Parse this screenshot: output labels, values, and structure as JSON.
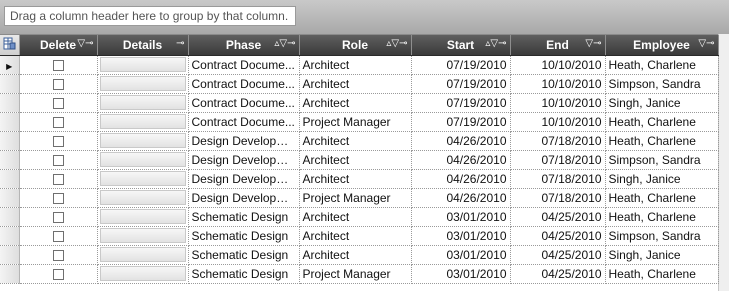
{
  "group_panel": {
    "hint": "Drag a column header here to group by that column."
  },
  "columns": [
    {
      "key": "delete",
      "label": "Delete",
      "icons": "▽⊸"
    },
    {
      "key": "details",
      "label": "Details",
      "icons": "⊸"
    },
    {
      "key": "phase",
      "label": "Phase",
      "icons": "▵▽⊸"
    },
    {
      "key": "role",
      "label": "Role",
      "icons": "▵▽⊸"
    },
    {
      "key": "start",
      "label": "Start",
      "icons": "▵▽⊸"
    },
    {
      "key": "end",
      "label": "End",
      "icons": "▽⊸"
    },
    {
      "key": "employee",
      "label": "Employee",
      "icons": "▽⊸"
    }
  ],
  "icons": {
    "corner": "column-chooser-icon",
    "filter": "filter-icon",
    "sort": "sort-icon",
    "pin": "pin-icon",
    "current_row": "current-row-arrow-icon"
  },
  "rows": [
    {
      "phase": "Contract Docume...",
      "role": "Architect",
      "start": "07/19/2010",
      "end": "10/10/2010",
      "employee": "Heath, Charlene"
    },
    {
      "phase": "Contract Docume...",
      "role": "Architect",
      "start": "07/19/2010",
      "end": "10/10/2010",
      "employee": "Simpson, Sandra"
    },
    {
      "phase": "Contract Docume...",
      "role": "Architect",
      "start": "07/19/2010",
      "end": "10/10/2010",
      "employee": "Singh, Janice"
    },
    {
      "phase": "Contract Docume...",
      "role": "Project Manager",
      "start": "07/19/2010",
      "end": "10/10/2010",
      "employee": "Heath, Charlene"
    },
    {
      "phase": "Design Developm...",
      "role": "Architect",
      "start": "04/26/2010",
      "end": "07/18/2010",
      "employee": "Heath, Charlene"
    },
    {
      "phase": "Design Developm...",
      "role": "Architect",
      "start": "04/26/2010",
      "end": "07/18/2010",
      "employee": "Simpson, Sandra"
    },
    {
      "phase": "Design Developm...",
      "role": "Architect",
      "start": "04/26/2010",
      "end": "07/18/2010",
      "employee": "Singh, Janice"
    },
    {
      "phase": "Design Developm...",
      "role": "Project Manager",
      "start": "04/26/2010",
      "end": "07/18/2010",
      "employee": "Heath, Charlene"
    },
    {
      "phase": "Schematic Design",
      "role": "Architect",
      "start": "03/01/2010",
      "end": "04/25/2010",
      "employee": "Heath, Charlene"
    },
    {
      "phase": "Schematic Design",
      "role": "Architect",
      "start": "03/01/2010",
      "end": "04/25/2010",
      "employee": "Simpson, Sandra"
    },
    {
      "phase": "Schematic Design",
      "role": "Architect",
      "start": "03/01/2010",
      "end": "04/25/2010",
      "employee": "Singh, Janice"
    },
    {
      "phase": "Schematic Design",
      "role": "Project Manager",
      "start": "03/01/2010",
      "end": "04/25/2010",
      "employee": "Heath, Charlene"
    }
  ]
}
